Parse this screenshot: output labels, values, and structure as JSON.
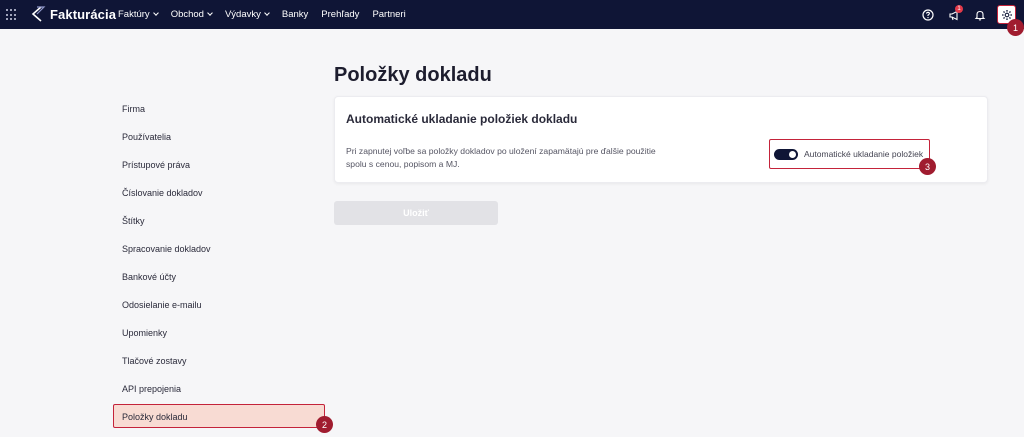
{
  "app": {
    "logo_text": "Fakturácia"
  },
  "nav": [
    {
      "label": "Faktúry",
      "dropdown": true
    },
    {
      "label": "Obchod",
      "dropdown": true
    },
    {
      "label": "Výdavky",
      "dropdown": true
    },
    {
      "label": "Banky",
      "dropdown": false
    },
    {
      "label": "Prehľady",
      "dropdown": false
    },
    {
      "label": "Partneri",
      "dropdown": false
    }
  ],
  "topbar": {
    "notification_count": "1"
  },
  "markers": {
    "m1": "1",
    "m2": "2",
    "m3": "3"
  },
  "sidebar": {
    "items": [
      "Firma",
      "Používatelia",
      "Prístupové práva",
      "Číslovanie dokladov",
      "Štítky",
      "Spracovanie dokladov",
      "Bankové účty",
      "Odosielanie e-mailu",
      "Upomienky",
      "Tlačové zostavy",
      "API prepojenia",
      "Položky dokladu"
    ],
    "active_index": 11
  },
  "main": {
    "page_title": "Položky dokladu",
    "card_title": "Automatické ukladanie položiek dokladu",
    "card_description": "Pri zapnutej voľbe sa položky dokladov po uložení zapamätajú pre ďalšie použitie spolu s cenou, popisom a MJ.",
    "toggle_label": "Automatické ukladanie položiek",
    "toggle_on": true,
    "save_label": "Uložiť"
  },
  "colors": {
    "topbar": "#0f1536",
    "highlight": "#c4233a",
    "marker": "#a01c2f",
    "active_bg": "#f8dbd3"
  }
}
